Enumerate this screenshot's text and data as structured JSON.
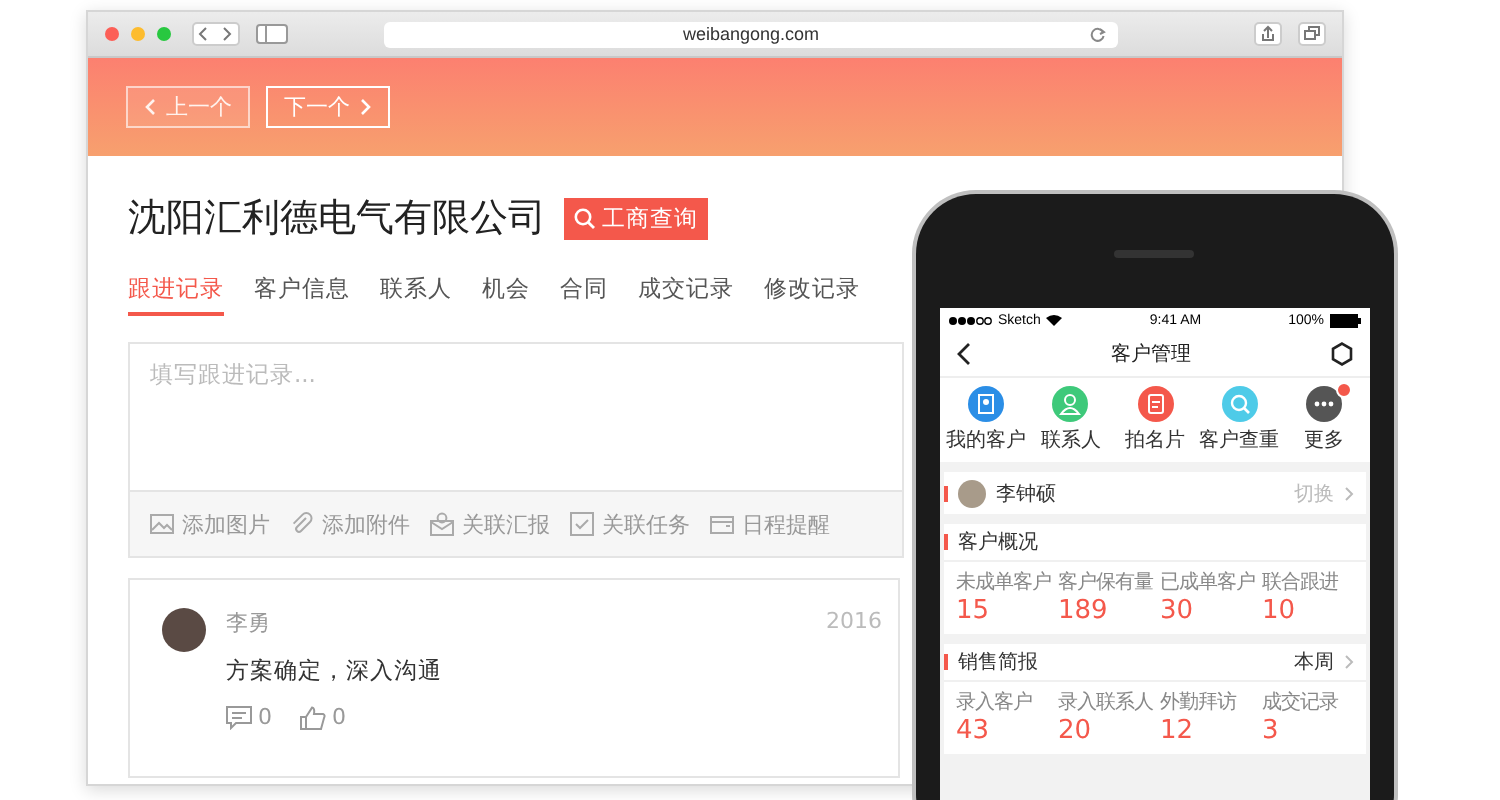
{
  "browser": {
    "url": "weibangong.com"
  },
  "pager": [
    {
      "label": "上一个",
      "kind": "prev",
      "disabled": true
    },
    {
      "label": "下一个",
      "kind": "next",
      "disabled": false
    }
  ],
  "company": {
    "name": "沈阳汇利德电气有限公司",
    "lookup_button": "工商查询"
  },
  "tabs": [
    {
      "label": "跟进记录",
      "selected": true
    },
    {
      "label": "客户信息",
      "selected": false
    },
    {
      "label": "联系人",
      "selected": false
    },
    {
      "label": "机会",
      "selected": false
    },
    {
      "label": "合同",
      "selected": false
    },
    {
      "label": "成交记录",
      "selected": false
    },
    {
      "label": "修改记录",
      "selected": false
    }
  ],
  "editor": {
    "placeholder": "填写跟进记录...",
    "tools": [
      {
        "label": "添加图片",
        "kind": "image"
      },
      {
        "label": "添加附件",
        "kind": "clip"
      },
      {
        "label": "关联汇报",
        "kind": "report"
      },
      {
        "label": "关联任务",
        "kind": "task"
      },
      {
        "label": "日程提醒",
        "kind": "calendar"
      }
    ]
  },
  "feed": [
    {
      "author": "李勇",
      "date": "2016",
      "text": "方案确定，深入沟通",
      "comments": "0",
      "likes": "0"
    }
  ],
  "phone": {
    "status": {
      "carrier": "Sketch",
      "time": "9:41 AM",
      "battery": "100%"
    },
    "title": "客户管理",
    "shortcuts": [
      {
        "label": "我的客户",
        "kind": "person",
        "color": "#2b8ee6",
        "badge": false
      },
      {
        "label": "联系人",
        "kind": "contact",
        "color": "#3ec97a",
        "badge": false
      },
      {
        "label": "拍名片",
        "kind": "card",
        "color": "#f4584b",
        "badge": false
      },
      {
        "label": "客户查重",
        "kind": "search",
        "color": "#4ecbe8",
        "badge": false
      },
      {
        "label": "更多",
        "kind": "more",
        "color": "#555555",
        "badge": true
      }
    ],
    "contact": {
      "name": "李钟硕",
      "action": "切换"
    },
    "sections": [
      {
        "title": "客户概况",
        "stats": [
          {
            "label": "未成单客户",
            "value": "15"
          },
          {
            "label": "客户保有量",
            "value": "189"
          },
          {
            "label": "已成单客户",
            "value": "30"
          },
          {
            "label": "联合跟进",
            "value": "10"
          }
        ]
      },
      {
        "title": "销售简报",
        "link": "本周",
        "stats": [
          {
            "label": "录入客户",
            "value": "43"
          },
          {
            "label": "录入联系人",
            "value": "20"
          },
          {
            "label": "外勤拜访",
            "value": "12"
          },
          {
            "label": "成交记录",
            "value": "3"
          }
        ]
      }
    ]
  }
}
